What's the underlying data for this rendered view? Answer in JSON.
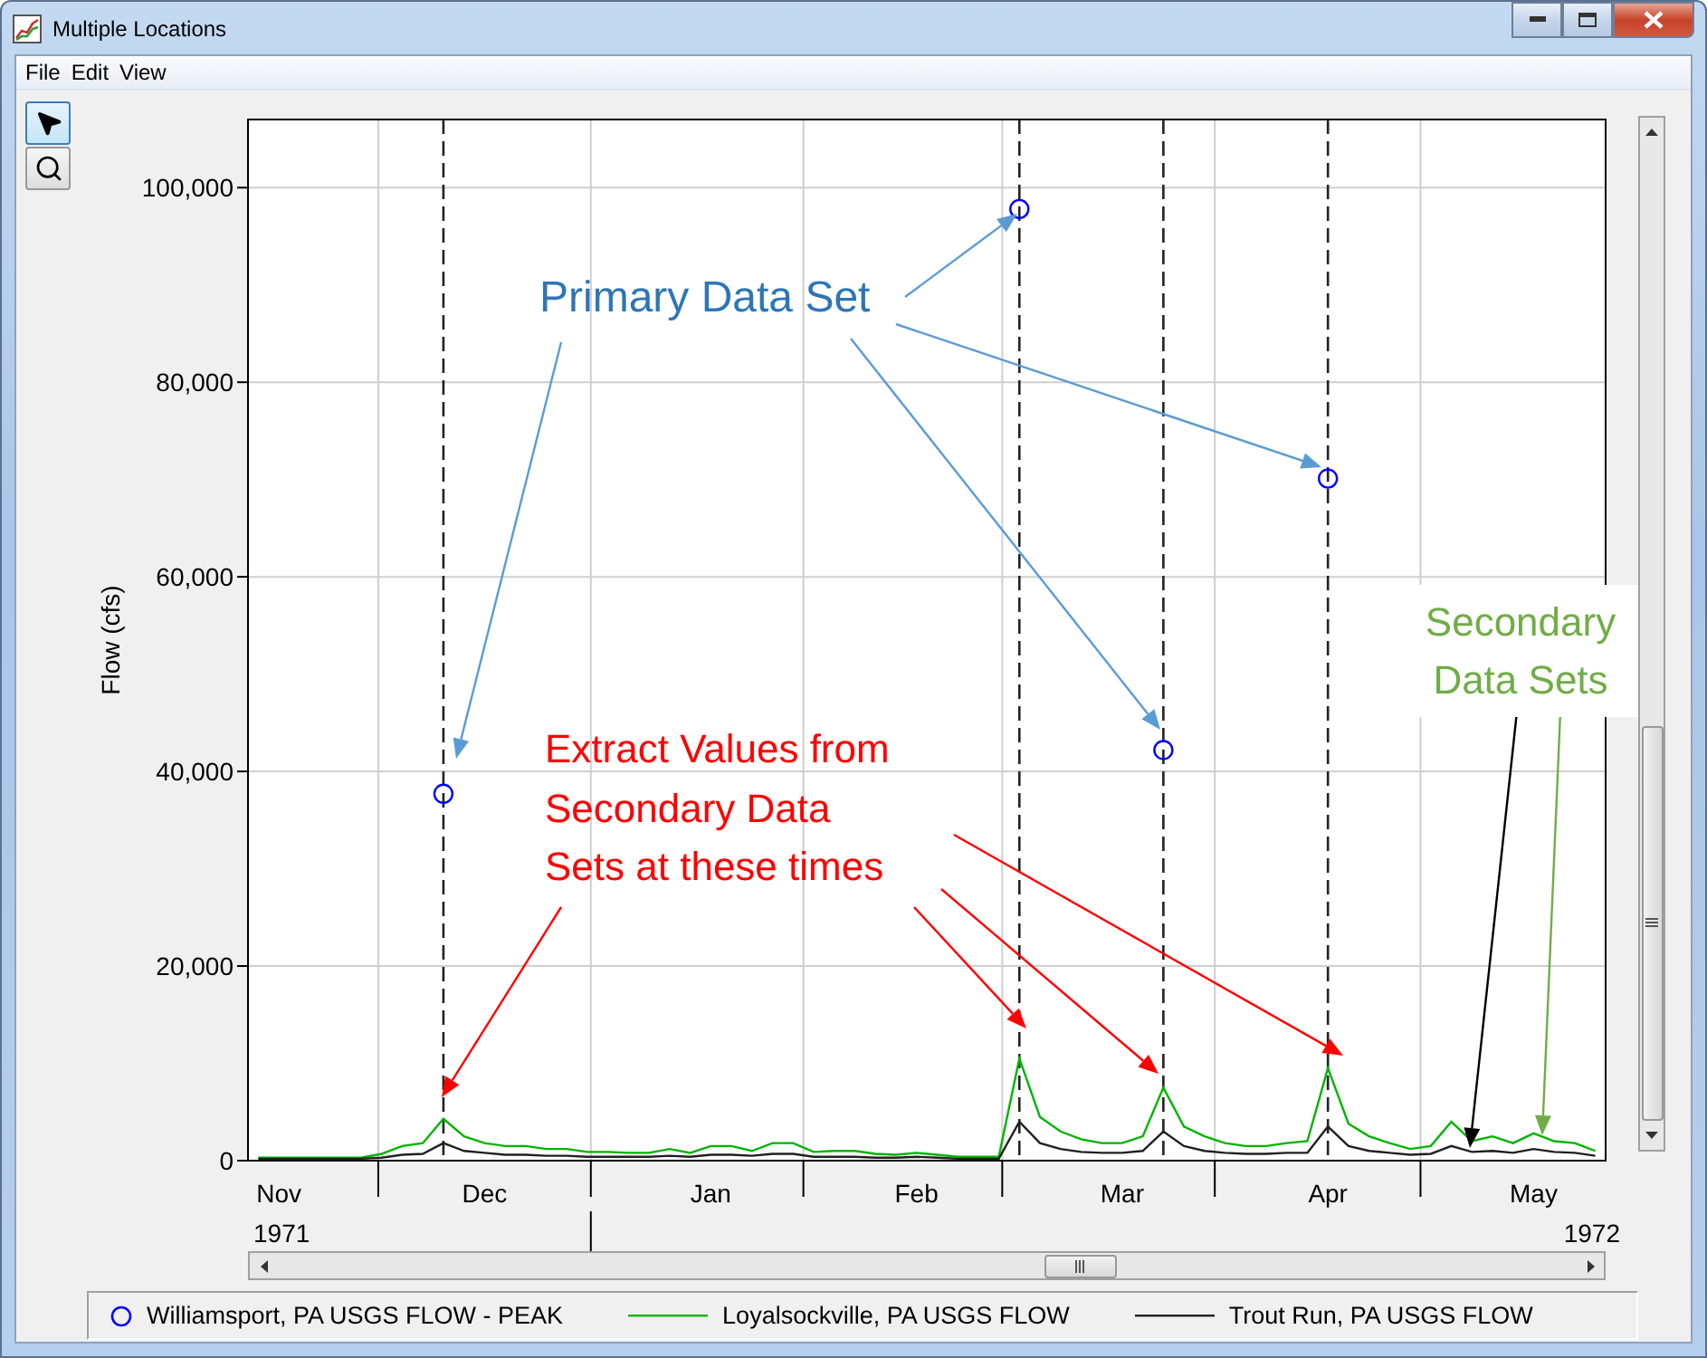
{
  "window": {
    "title": "Multiple Locations"
  },
  "menu": [
    "File",
    "Edit",
    "View"
  ],
  "tools": [
    {
      "kind": "pointer",
      "selected": true
    },
    {
      "kind": "zoom",
      "selected": false
    }
  ],
  "chart_data": {
    "type": "line",
    "grid": true,
    "ylabel": "Flow (cfs)",
    "ylim": [
      0,
      107000
    ],
    "yticks": [
      {
        "value": 0,
        "label": "0"
      },
      {
        "value": 20000,
        "label": "20,000"
      },
      {
        "value": 40000,
        "label": "40,000"
      },
      {
        "value": 60000,
        "label": "60,000"
      },
      {
        "value": 80000,
        "label": "80,000"
      },
      {
        "value": 100000,
        "label": "100,000"
      }
    ],
    "categories": [
      null,
      "Nov",
      null,
      null,
      null,
      null,
      null,
      null,
      null,
      null,
      null,
      "Dec",
      null,
      null,
      null,
      null,
      null,
      null,
      null,
      null,
      null,
      null,
      "Jan",
      null,
      null,
      null,
      null,
      null,
      null,
      null,
      null,
      null,
      "Feb",
      null,
      null,
      null,
      null,
      null,
      null,
      null,
      null,
      null,
      "Mar",
      null,
      null,
      null,
      null,
      null,
      null,
      null,
      null,
      null,
      "Apr",
      null,
      null,
      null,
      null,
      null,
      null,
      null,
      null,
      null,
      "May",
      null,
      null,
      null
    ],
    "series": [
      {
        "type": "scatter",
        "color": "#0000ff",
        "values": [
          null,
          null,
          null,
          null,
          null,
          null,
          null,
          null,
          null,
          37700,
          null,
          null,
          null,
          null,
          null,
          null,
          null,
          null,
          null,
          null,
          null,
          null,
          null,
          null,
          null,
          null,
          null,
          null,
          null,
          null,
          null,
          null,
          null,
          null,
          null,
          null,
          null,
          97800,
          null,
          null,
          null,
          null,
          null,
          null,
          42200,
          null,
          null,
          null,
          null,
          null,
          null,
          null,
          70100,
          null,
          null,
          null,
          null,
          null,
          null,
          null,
          null,
          null,
          null,
          null,
          null,
          null
        ]
      },
      {
        "color": "#00b400",
        "values": [
          300,
          300,
          300,
          300,
          300,
          300,
          700,
          1500,
          1800,
          4300,
          2500,
          1800,
          1500,
          1500,
          1200,
          1200,
          900,
          900,
          800,
          800,
          1200,
          800,
          1500,
          1500,
          1000,
          1800,
          1800,
          900,
          1000,
          1000,
          700,
          600,
          800,
          600,
          400,
          400,
          400,
          10500,
          4500,
          3000,
          2200,
          1800,
          1800,
          2500,
          7500,
          3500,
          2500,
          1800,
          1500,
          1500,
          1800,
          2000,
          9500,
          3800,
          2500,
          1800,
          1200,
          1500,
          4000,
          2000,
          2500,
          1800,
          2800,
          2000,
          1800,
          1000
        ]
      },
      {
        "color": "#202020",
        "values": [
          200,
          200,
          200,
          200,
          200,
          200,
          300,
          600,
          700,
          1800,
          1000,
          800,
          600,
          600,
          500,
          500,
          400,
          400,
          400,
          400,
          500,
          400,
          600,
          600,
          500,
          700,
          700,
          400,
          400,
          400,
          300,
          300,
          400,
          300,
          200,
          200,
          200,
          4000,
          1800,
          1200,
          900,
          800,
          800,
          1000,
          3000,
          1500,
          1000,
          800,
          700,
          700,
          800,
          800,
          3500,
          1500,
          1000,
          800,
          600,
          700,
          1500,
          900,
          1000,
          800,
          1200,
          900,
          800,
          500
        ]
      }
    ]
  },
  "time_axis": {
    "years": [
      "1971",
      "1972"
    ]
  },
  "callouts": [
    {
      "lines": [
        "Primary Data Set"
      ],
      "color": "#2e75b6",
      "arrows": [
        {
          "color": "#5b9bd5"
        },
        {
          "color": "#5b9bd5"
        },
        {
          "color": "#5b9bd5"
        },
        {
          "color": "#5b9bd5"
        }
      ]
    },
    {
      "lines": [
        "Extract Values from",
        "Secondary Data",
        "Sets at these times"
      ],
      "color": "#ff0000",
      "arrows": [
        {
          "color": "#ff0000"
        },
        {
          "color": "#ff0000"
        },
        {
          "color": "#ff0000"
        },
        {
          "color": "#ff0000"
        }
      ]
    },
    {
      "lines": [
        "Secondary",
        "Data Sets"
      ],
      "color": "#70ad47",
      "arrows": [
        {
          "color": "#000000"
        },
        {
          "color": "#70ad47"
        }
      ]
    }
  ],
  "legend": [
    {
      "label": "Williamsport, PA USGS FLOW - PEAK",
      "kind": "marker",
      "color": "#0000ff"
    },
    {
      "label": "Loyalsockville, PA USGS FLOW",
      "kind": "line",
      "color": "#00b400"
    },
    {
      "label": "Trout Run, PA USGS FLOW",
      "kind": "line",
      "color": "#202020"
    }
  ]
}
